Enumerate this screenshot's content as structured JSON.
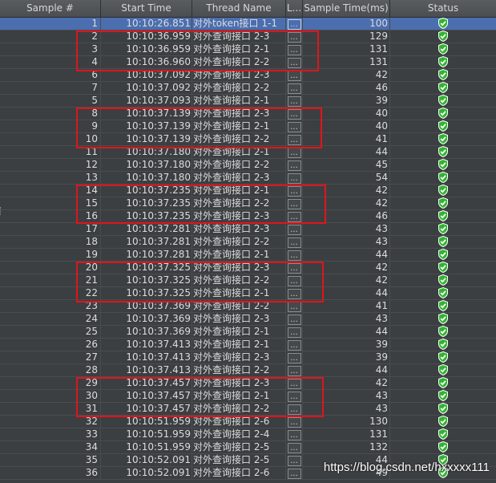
{
  "columns": {
    "sample": "Sample #",
    "start": "Start Time",
    "thread": "Thread Name",
    "label": "L...",
    "time": "Sample Time(ms)",
    "status": "Status"
  },
  "label_cell": "...",
  "rows": [
    {
      "num": "1",
      "start": "10:10:26.851",
      "thread": "对外token接口 1-1",
      "time": "100",
      "selected": true
    },
    {
      "num": "2",
      "start": "10:10:36.959",
      "thread": "对外查询接口 2-3",
      "time": "129"
    },
    {
      "num": "3",
      "start": "10:10:36.959",
      "thread": "对外查询接口 2-1",
      "time": "131"
    },
    {
      "num": "4",
      "start": "10:10:36.960",
      "thread": "对外查询接口 2-2",
      "time": "131"
    },
    {
      "num": "6",
      "start": "10:10:37.092",
      "thread": "对外查询接口 2-3",
      "time": "42"
    },
    {
      "num": "7",
      "start": "10:10:37.092",
      "thread": "对外查询接口 2-2",
      "time": "46"
    },
    {
      "num": "5",
      "start": "10:10:37.093",
      "thread": "对外查询接口 2-1",
      "time": "39"
    },
    {
      "num": "8",
      "start": "10:10:37.139",
      "thread": "对外查询接口 2-3",
      "time": "40"
    },
    {
      "num": "9",
      "start": "10:10:37.139",
      "thread": "对外查询接口 2-1",
      "time": "40"
    },
    {
      "num": "10",
      "start": "10:10:37.139",
      "thread": "对外查询接口 2-2",
      "time": "41"
    },
    {
      "num": "11",
      "start": "10:10:37.180",
      "thread": "对外查询接口 2-1",
      "time": "44"
    },
    {
      "num": "12",
      "start": "10:10:37.180",
      "thread": "对外查询接口 2-2",
      "time": "45"
    },
    {
      "num": "13",
      "start": "10:10:37.180",
      "thread": "对外查询接口 2-3",
      "time": "54"
    },
    {
      "num": "14",
      "start": "10:10:37.235",
      "thread": "对外查询接口 2-1",
      "time": "42"
    },
    {
      "num": "15",
      "start": "10:10:37.235",
      "thread": "对外查询接口 2-2",
      "time": "42"
    },
    {
      "num": "16",
      "start": "10:10:37.235",
      "thread": "对外查询接口 2-3",
      "time": "46"
    },
    {
      "num": "17",
      "start": "10:10:37.281",
      "thread": "对外查询接口 2-3",
      "time": "43"
    },
    {
      "num": "18",
      "start": "10:10:37.281",
      "thread": "对外查询接口 2-2",
      "time": "43"
    },
    {
      "num": "19",
      "start": "10:10:37.281",
      "thread": "对外查询接口 2-1",
      "time": "44"
    },
    {
      "num": "20",
      "start": "10:10:37.325",
      "thread": "对外查询接口 2-3",
      "time": "42"
    },
    {
      "num": "21",
      "start": "10:10:37.325",
      "thread": "对外查询接口 2-2",
      "time": "42"
    },
    {
      "num": "22",
      "start": "10:10:37.325",
      "thread": "对外查询接口 2-1",
      "time": "44"
    },
    {
      "num": "23",
      "start": "10:10:37.369",
      "thread": "对外查询接口 2-2",
      "time": "41"
    },
    {
      "num": "24",
      "start": "10:10:37.369",
      "thread": "对外查询接口 2-3",
      "time": "43"
    },
    {
      "num": "25",
      "start": "10:10:37.369",
      "thread": "对外查询接口 2-1",
      "time": "44"
    },
    {
      "num": "26",
      "start": "10:10:37.413",
      "thread": "对外查询接口 2-1",
      "time": "39"
    },
    {
      "num": "27",
      "start": "10:10:37.413",
      "thread": "对外查询接口 2-3",
      "time": "39"
    },
    {
      "num": "28",
      "start": "10:10:37.413",
      "thread": "对外查询接口 2-2",
      "time": "44"
    },
    {
      "num": "29",
      "start": "10:10:37.457",
      "thread": "对外查询接口 2-3",
      "time": "42"
    },
    {
      "num": "30",
      "start": "10:10:37.457",
      "thread": "对外查询接口 2-1",
      "time": "43"
    },
    {
      "num": "31",
      "start": "10:10:37.457",
      "thread": "对外查询接口 2-2",
      "time": "43"
    },
    {
      "num": "32",
      "start": "10:10:51.959",
      "thread": "对外查询接口 2-6",
      "time": "130"
    },
    {
      "num": "33",
      "start": "10:10:51.959",
      "thread": "对外查询接口 2-4",
      "time": "131"
    },
    {
      "num": "34",
      "start": "10:10:51.959",
      "thread": "对外查询接口 2-5",
      "time": "132"
    },
    {
      "num": "35",
      "start": "10:10:52.091",
      "thread": "对外查询接口 2-5",
      "time": "44"
    },
    {
      "num": "36",
      "start": "10:10:52.091",
      "thread": "对外查询接口 2-6",
      "time": "49"
    }
  ],
  "status_icon": "check-shield-icon",
  "colors": {
    "status_ok": "#2fb52f",
    "highlight": "#e0141c",
    "selected_row": "#4b6eaf"
  },
  "watermark": "https://blog.csdn.net/hxxxxx111"
}
